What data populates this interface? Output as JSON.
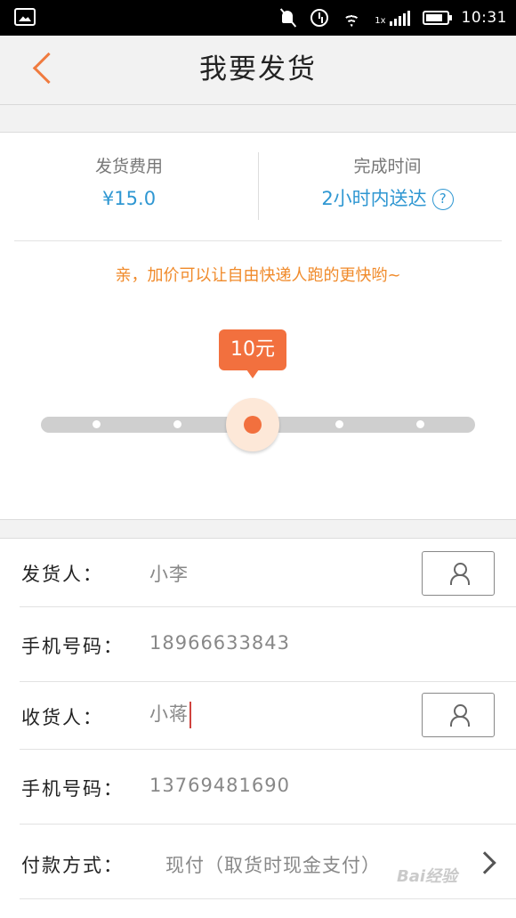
{
  "status_bar": {
    "time": "10:31",
    "signal_label": "1x",
    "icons": [
      "image-icon",
      "mute-icon",
      "alarm-icon",
      "wifi-icon",
      "signal-icon",
      "battery-icon"
    ]
  },
  "header": {
    "title": "我要发货",
    "back_icon": "chevron-left-icon"
  },
  "summary": {
    "fee_label": "发货费用",
    "fee_value": "¥15.0",
    "time_label": "完成时间",
    "time_value": "2小时内送达",
    "help_symbol": "?"
  },
  "promo": {
    "text": "亲，加价可以让自由快递人跑的更快哟~"
  },
  "slider": {
    "selected_label": "10元",
    "stops": 6,
    "selected_index": 2
  },
  "form": {
    "sender_label": "发货人：",
    "sender_value": "小李",
    "sender_phone_label": "手机号码：",
    "sender_phone_value": "18966633843",
    "receiver_label": "收货人：",
    "receiver_value": "小蒋",
    "receiver_phone_label": "手机号码：",
    "receiver_phone_value": "13769481690",
    "payment_label": "付款方式：",
    "payment_value": "现付（取货时现金支付）"
  },
  "watermark": "Bai经验",
  "colors": {
    "accent_orange": "#f2703e",
    "link_blue": "#2f97d2",
    "promo_orange": "#f08a2a"
  }
}
